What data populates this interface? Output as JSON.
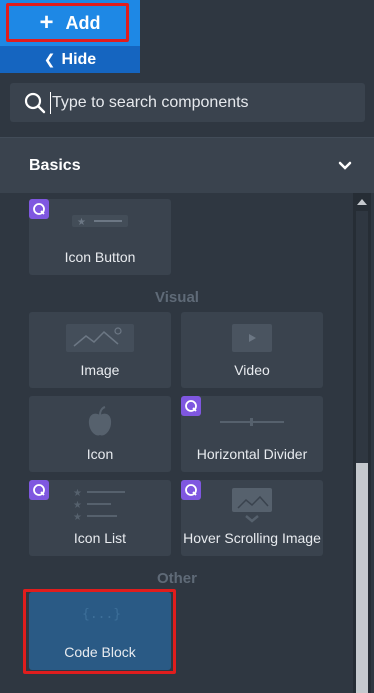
{
  "toolbar": {
    "add_label": "Add",
    "hide_label": "Hide"
  },
  "search": {
    "placeholder": "Type to search components"
  },
  "section": {
    "title": "Basics"
  },
  "groups": {
    "visual": "Visual",
    "other": "Other"
  },
  "cards": {
    "icon_button": "Icon Button",
    "image": "Image",
    "video": "Video",
    "icon": "Icon",
    "horizontal_divider": "Horizontal Divider",
    "icon_list": "Icon List",
    "hover_scrolling_image": "Hover Scrolling Image",
    "code_block": "Code Block"
  },
  "colors": {
    "accent": "#1e88e5",
    "badge": "#7f57e0",
    "highlight": "#e11d1d",
    "selected": "#2a5a85"
  }
}
